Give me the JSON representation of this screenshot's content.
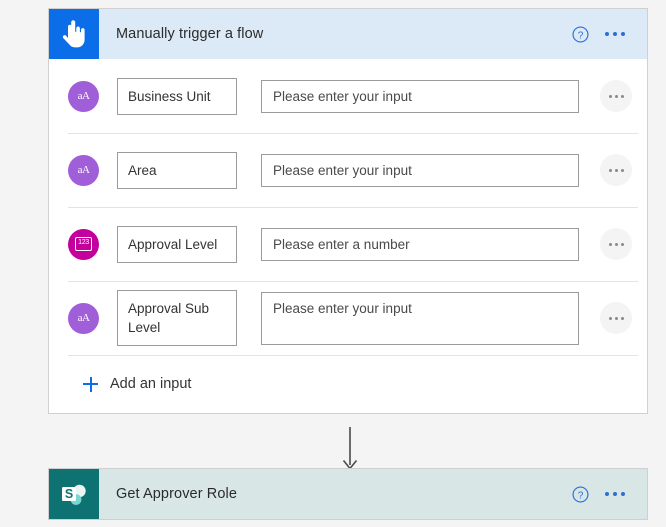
{
  "trigger_card": {
    "icon": "tap-hand-icon",
    "icon_bg": "#0b6ee8",
    "header_bg": "#dceaf7",
    "title": "Manually trigger a flow",
    "help_icon": "help-circle-icon",
    "more_icon": "ellipsis-icon",
    "inputs": [
      {
        "type_icon": "text-type-icon",
        "type_glyph": "aA",
        "type_color": "#a05fd8",
        "name": "Business Unit",
        "placeholder": "Please enter your input",
        "row_menu_icon": "ellipsis-icon",
        "multiline": false
      },
      {
        "type_icon": "text-type-icon",
        "type_glyph": "aA",
        "type_color": "#a05fd8",
        "name": "Area",
        "placeholder": "Please enter your input",
        "row_menu_icon": "ellipsis-icon",
        "multiline": false
      },
      {
        "type_icon": "number-type-icon",
        "type_glyph": "123",
        "type_color": "#c3009b",
        "name": "Approval Level",
        "placeholder": "Please enter a number",
        "row_menu_icon": "ellipsis-icon",
        "multiline": false
      },
      {
        "type_icon": "text-type-icon",
        "type_glyph": "aA",
        "type_color": "#a05fd8",
        "name": "Approval Sub Level",
        "placeholder": "Please enter your input",
        "row_menu_icon": "ellipsis-icon",
        "multiline": true
      }
    ],
    "add_input": {
      "icon": "plus-icon",
      "label": "Add an input",
      "accent": "#0b6ee8"
    }
  },
  "connector": {
    "icon": "down-arrow-icon",
    "color": "#4a4a4a"
  },
  "action_card": {
    "icon": "sharepoint-icon",
    "icon_bg": "#0d7271",
    "header_bg": "#d9e6e6",
    "title": "Get Approver Role",
    "help_icon": "help-circle-icon",
    "more_icon": "ellipsis-icon"
  }
}
